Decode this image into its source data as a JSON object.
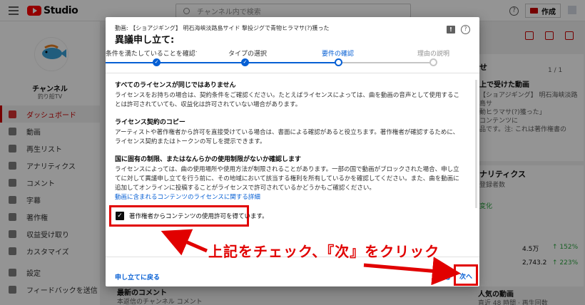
{
  "app": {
    "logo": "Studio"
  },
  "search": {
    "placeholder": "チャンネル内で検索"
  },
  "header": {
    "create_label": "作成",
    "help": "?"
  },
  "channel": {
    "title": "チャンネル",
    "subtitle": "釣り船TV",
    "logo_text": "釣り船TV"
  },
  "sidebar": {
    "items": [
      {
        "label": "ダッシュボード",
        "icon": "dashboard-icon",
        "active": true
      },
      {
        "label": "動画",
        "icon": "video-icon"
      },
      {
        "label": "再生リスト",
        "icon": "playlist-icon"
      },
      {
        "label": "アナリティクス",
        "icon": "analytics-icon"
      },
      {
        "label": "コメント",
        "icon": "comment-icon"
      },
      {
        "label": "字幕",
        "icon": "subtitles-icon"
      },
      {
        "label": "著作権",
        "icon": "copyright-icon"
      },
      {
        "label": "収益受け取り",
        "icon": "dollar-icon"
      },
      {
        "label": "カスタマイズ",
        "icon": "customize-icon"
      }
    ],
    "footer": [
      {
        "label": "設定",
        "icon": "gear-icon"
      },
      {
        "label": "フィードバックを送信",
        "icon": "feedback-icon"
      }
    ]
  },
  "background": {
    "right_card_title": "せ",
    "right_card_subtitle": "上で受けた動画",
    "pager": "1 / 1",
    "right_card_text": "【ショアジギング】 明石海峡淡路島サ\n動ヒラマサ(?)獲った」\nコンテンツに\n品です。注: これは著作権書の",
    "analytics_title": "ナリティクス",
    "analytics_sub": "登録者数",
    "analytics_change": "変化",
    "stat1_value": "4.5万",
    "stat1_change": "↑ 152%",
    "stat2_value": "2,743.2",
    "stat2_change": "↑ 223%",
    "popular_title": "人気の動画",
    "popular_sub": "直近 48 時間 · 再生回数",
    "latest_comments_title": "最新のコメント",
    "latest_comments_sub": "本返信のチャンネル コメント"
  },
  "dialog": {
    "video_title": "動画: 【ショアジギング】 明石海峡淡路島サイド 撃投ジグで青物ヒラマサ(?)獲った",
    "title": "異議申し立て:",
    "steps": [
      {
        "label": "条件を満たしていることを確認する",
        "state": "done"
      },
      {
        "label": "タイプの選択",
        "state": "done"
      },
      {
        "label": "要件の確認",
        "state": "current"
      },
      {
        "label": "理由の説明",
        "state": "future"
      }
    ],
    "sections": [
      {
        "heading": "すべてのライセンスが同じではありません",
        "body": "ライセンスをお持ちの場合は、契約条件をご確認ください。たとえばライセンスによっては、曲を動画の音声として使用することは許可されていても、収益化は許可されていない場合があります。"
      },
      {
        "heading": "ライセンス契約のコピー",
        "body": "アーティストや著作権者から許可を直接受けている場合は、書面による確認があると役立ちます。著作権者が確認するために、ライセンス契約またはトークンの写しを提示できます。"
      },
      {
        "heading": "国に固有の制限、またはなんらかの使用制限がないか確認します",
        "body": "ライセンスによっては、曲の使用場所や使用方法が制限されることがあります。一部の国で動画がブロックされた場合、申し立てに対して異議申し立てを行う前に、その地域において該当する権利を所有しているかを確認してください。また、曲を動画に追加してオンラインに投稿することがライセンスで許可されているかどうかもご確認ください。"
      }
    ],
    "license_link": "動画に含まれるコンテンツのライセンスに関する詳細",
    "checkbox_label": "著作権者からコンテンツの使用許可を得ています。",
    "checkbox_checked": true,
    "appeal_back": "申し立てに戻る",
    "back_label": "戻る",
    "next_label": "次へ"
  },
  "annotation": {
    "text": "上記をチェック、『次』をクリック",
    "color": "#e10000"
  },
  "colors": {
    "accent": "#065fd4",
    "brand": "#ff0000",
    "annotation": "#e10000"
  }
}
